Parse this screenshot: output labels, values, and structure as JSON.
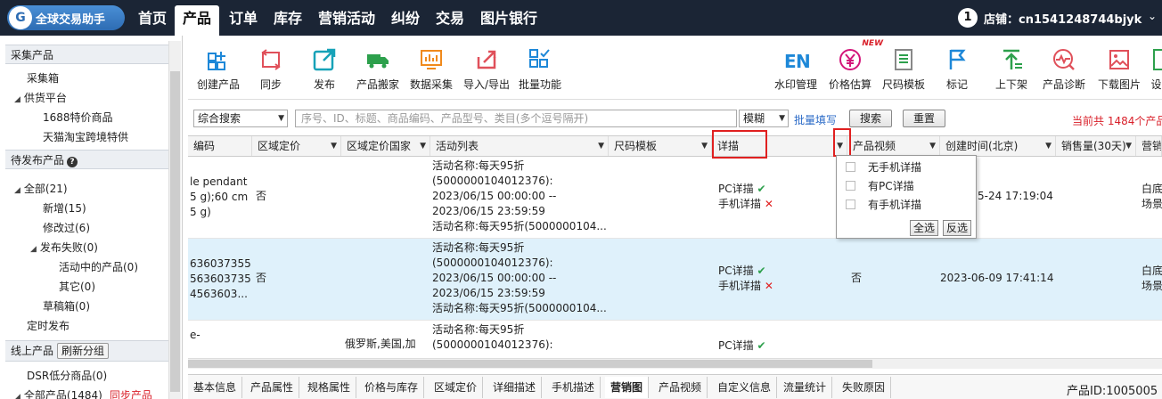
{
  "app": {
    "logo_text": "全球交易助手",
    "shop_number": "1",
    "shop_label": "店铺：cn1541248744bjyk",
    "shop_arrow": "⌄"
  },
  "nav": {
    "tabs": [
      "首页",
      "产品",
      "订单",
      "库存",
      "营销活动",
      "纠纷",
      "交易",
      "图片银行"
    ],
    "active": "产品"
  },
  "sidebar": {
    "section1": {
      "title": "采集产品",
      "items": [
        "采集箱",
        "供货平台",
        "1688特价商品",
        "天猫淘宝跨境特供"
      ]
    },
    "section2": {
      "title": "待发布产品",
      "help": "?",
      "items": [
        "全部(21)",
        "新增(15)",
        "修改过(6)",
        "发布失败(0)",
        "活动中的产品(0)",
        "其它(0)",
        "草稿箱(0)",
        "定时发布"
      ]
    },
    "section3": {
      "title": "线上产品",
      "regroup_button": "刷新分组",
      "items": [
        "DSR低分商品(0)",
        "全部产品(1484)",
        "同步产品"
      ]
    }
  },
  "toolbar": {
    "left": [
      "创建产品",
      "同步",
      "发布",
      "产品搬家",
      "数据采集",
      "导入/导出",
      "批量功能"
    ],
    "right": [
      "水印管理",
      "价格估算",
      "尺码模板",
      "标记",
      "上下架",
      "产品诊断",
      "下载图片",
      "设"
    ],
    "new_badge": "NEW",
    "colors": {
      "blue": "#1e88d8",
      "red": "#e0505a",
      "orange": "#f08a1c",
      "teal": "#17a2b8",
      "magenta": "#d3167a",
      "green": "#2da04c"
    }
  },
  "search": {
    "type_select": "综合搜索",
    "placeholder": "序号、ID、标题、商品编码、产品型号、类目(多个逗号隔开)",
    "mode_select": "模糊",
    "bulk_fill_link": "批量填写",
    "search_button": "搜索",
    "reset_button": "重置",
    "total_text": "当前共 1484个产品"
  },
  "grid": {
    "columns": [
      "编码",
      "区域定价",
      "区域定价国家",
      "活动列表",
      "尺码模板",
      "详描",
      "产品视频",
      "创建时间(北京)",
      "销售量(30天)",
      "营销"
    ],
    "rows": [
      {
        "code": [
          "le pendant",
          "5 g);60 cm",
          "5 g)"
        ],
        "area_price": "否",
        "area_country": "",
        "activity": [
          "活动名称:每天95折",
          "(5000000104012376):",
          "2023/06/15 00:00:00 --",
          "2023/06/15 23:59:59",
          "活动名称:每天95折(5000000104..."
        ],
        "detail_pc": "PC详描",
        "detail_mobile": "手机详描",
        "video": "",
        "created": "5-24 17:19:04",
        "marketing": [
          "白底",
          "场景"
        ]
      },
      {
        "code": [
          "636037355",
          "563603735",
          "4563603..."
        ],
        "area_price": "否",
        "area_country": "",
        "activity": [
          "活动名称:每天95折",
          "(5000000104012376):",
          "2023/06/15 00:00:00 --",
          "2023/06/15 23:59:59",
          "活动名称:每天95折(5000000104..."
        ],
        "detail_pc": "PC详描",
        "detail_mobile": "手机详描",
        "video": "否",
        "created": "2023-06-09 17:41:14",
        "marketing": [
          "白底",
          "场景"
        ]
      },
      {
        "code": [
          "e-"
        ],
        "area_price": "",
        "area_country": "俄罗斯,美国,加",
        "activity": [
          "活动名称:每天95折",
          "(5000000104012376):"
        ],
        "detail_pc": "PC详描",
        "detail_mobile": "",
        "video": "",
        "created": "",
        "marketing": []
      }
    ]
  },
  "filter_dropdown": {
    "options": [
      "无手机详描",
      "有PC详描",
      "有手机详描"
    ],
    "select_all": "全选",
    "invert": "反选"
  },
  "bottom_tabs": {
    "tabs": [
      "基本信息",
      "产品属性",
      "规格属性",
      "价格与库存",
      "区域定价",
      "详细描述",
      "手机描述",
      "营销图",
      "产品视频",
      "自定义信息",
      "流量统计",
      "失败原因"
    ],
    "active": "营销图",
    "product_id": "产品ID:1005005"
  }
}
